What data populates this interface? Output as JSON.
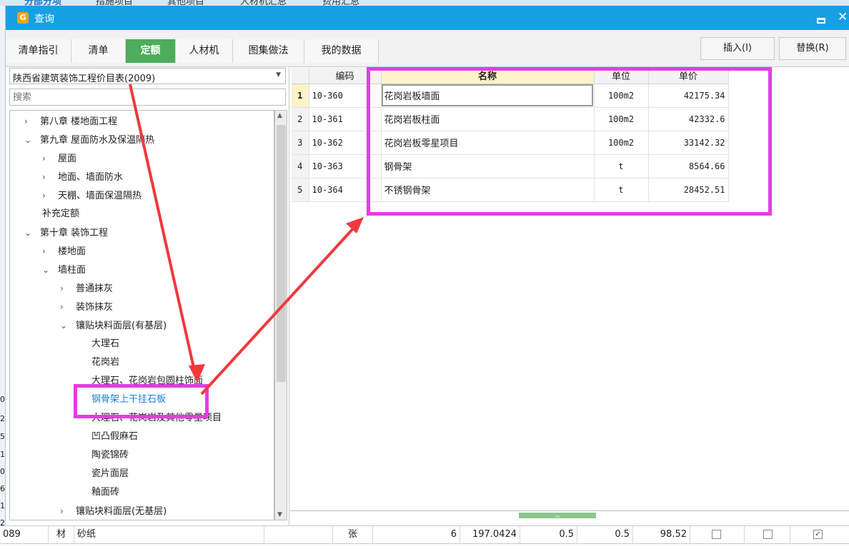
{
  "background_tabs": [
    "分部分项",
    "措施项目",
    "其他项目",
    "人材机汇总",
    "费用汇总"
  ],
  "window": {
    "title": "查询",
    "logo": "G"
  },
  "tabs": [
    {
      "label": "清单指引"
    },
    {
      "label": "清单"
    },
    {
      "label": "定额",
      "active": true
    },
    {
      "label": "人材机"
    },
    {
      "label": "图集做法"
    },
    {
      "label": "我的数据"
    }
  ],
  "actions": {
    "insert": "插入(I)",
    "replace": "替换(R)"
  },
  "left": {
    "dropdown_value": "陕西省建筑装饰工程价目表(2009)",
    "search_placeholder": "搜索",
    "tree": [
      {
        "label": "第八章 楼地面工程",
        "level": 0,
        "state": "collapsed"
      },
      {
        "label": "第九章 屋面防水及保温隔热",
        "level": 0,
        "state": "expanded"
      },
      {
        "label": "屋面",
        "level": 1,
        "state": "collapsed"
      },
      {
        "label": "地面、墙面防水",
        "level": 1,
        "state": "collapsed"
      },
      {
        "label": "天棚、墙面保温隔热",
        "level": 1,
        "state": "collapsed"
      },
      {
        "label": "补充定额",
        "level": 1,
        "state": "leaf"
      },
      {
        "label": "第十章 装饰工程",
        "level": 0,
        "state": "expanded"
      },
      {
        "label": "楼地面",
        "level": 1,
        "state": "collapsed"
      },
      {
        "label": "墙柱面",
        "level": 1,
        "state": "expanded"
      },
      {
        "label": "普通抹灰",
        "level": 2,
        "state": "collapsed"
      },
      {
        "label": "装饰抹灰",
        "level": 2,
        "state": "collapsed"
      },
      {
        "label": "镶贴块料面层(有基层)",
        "level": 2,
        "state": "expanded"
      },
      {
        "label": "大理石",
        "level": 3,
        "state": "leaf"
      },
      {
        "label": "花岗岩",
        "level": 3,
        "state": "leaf"
      },
      {
        "label": "大理石、花岗岩包圆柱饰面",
        "level": 3,
        "state": "leaf"
      },
      {
        "label": "钢骨架上干挂石板",
        "level": 3,
        "state": "leaf",
        "selected": true
      },
      {
        "label": "大理石、花岗岩及其他零星项目",
        "level": 3,
        "state": "leaf"
      },
      {
        "label": "凹凸假麻石",
        "level": 3,
        "state": "leaf"
      },
      {
        "label": "陶瓷锦砖",
        "level": 3,
        "state": "leaf"
      },
      {
        "label": "瓷片面层",
        "level": 3,
        "state": "leaf"
      },
      {
        "label": "釉面砖",
        "level": 3,
        "state": "leaf"
      },
      {
        "label": "镶贴块料面层(无基层)",
        "level": 2,
        "state": "collapsed"
      }
    ]
  },
  "grid": {
    "headers": {
      "code": "编码",
      "name": "名称",
      "unit": "单位",
      "price": "单价"
    },
    "rows": [
      {
        "no": "1",
        "code": "10-360",
        "name": "花岗岩板墙面",
        "unit": "100m2",
        "price": "42175.34"
      },
      {
        "no": "2",
        "code": "10-361",
        "name": "花岗岩板柱面",
        "unit": "100m2",
        "price": "42332.6"
      },
      {
        "no": "3",
        "code": "10-362",
        "name": "花岗岩板零星项目",
        "unit": "100m2",
        "price": "33142.32"
      },
      {
        "no": "4",
        "code": "10-363",
        "name": "钢骨架",
        "unit": "t",
        "price": "8564.66"
      },
      {
        "no": "5",
        "code": "10-364",
        "name": "不锈钢骨架",
        "unit": "t",
        "price": "28452.51"
      }
    ]
  },
  "bottom_row": {
    "code": "089",
    "type": "材",
    "name": "砂纸",
    "unit": "张",
    "v1": "6",
    "v2": "197.0424",
    "v3": "0.5",
    "v4": "0.5",
    "v5": "98.52",
    "c1": false,
    "c2": false,
    "c3": true
  },
  "left_edge_digits": [
    "0",
    "2",
    "5",
    "1",
    "0",
    "6",
    "1",
    "2"
  ],
  "colors": {
    "titlebar": "#17a0e3",
    "active_tab": "#4cad5a",
    "highlight_box": "#e23ee0",
    "arrow": "#f0393d",
    "tree_link": "#1b7fd6"
  }
}
